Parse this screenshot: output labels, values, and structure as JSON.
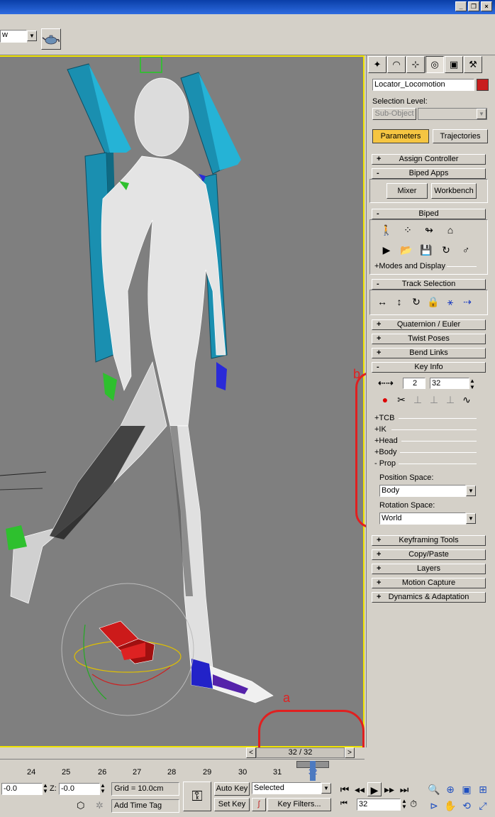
{
  "window": {
    "minimize": "_",
    "restore": "❐",
    "close": "×"
  },
  "toolbar": {
    "viewport_dropdown_value": "w"
  },
  "command_panel": {
    "object_name": "Locator_Locomotion",
    "object_color": "#cc2020",
    "selection_level_label": "Selection Level:",
    "subobject_button": "Sub-Object",
    "tabs": [
      "Parameters",
      "Trajectories"
    ],
    "rollouts_top": [
      {
        "sign": "+",
        "label": "Assign Controller"
      },
      {
        "sign": "-",
        "label": "Biped Apps"
      }
    ],
    "biped_apps": {
      "mixer": "Mixer",
      "workbench": "Workbench"
    },
    "biped_rollout": {
      "sign": "-",
      "label": "Biped"
    },
    "modes_and_display": "+Modes and Display",
    "track_selection": {
      "sign": "-",
      "label": "Track Selection"
    },
    "rollouts_mid": [
      {
        "sign": "+",
        "label": "Quaternion / Euler"
      },
      {
        "sign": "+",
        "label": "Twist Poses"
      },
      {
        "sign": "+",
        "label": "Bend Links"
      }
    ],
    "key_info": {
      "sign": "-",
      "label": "Key Info",
      "key_number": "2",
      "frame": "32",
      "subsections": [
        "+TCB",
        "+IK",
        "+Head",
        "+Body",
        "- Prop"
      ],
      "position_space_label": "Position Space:",
      "position_space_value": "Body",
      "rotation_space_label": "Rotation Space:",
      "rotation_space_value": "World"
    },
    "rollouts_bottom": [
      {
        "sign": "+",
        "label": "Keyframing Tools"
      },
      {
        "sign": "+",
        "label": "Copy/Paste"
      },
      {
        "sign": "+",
        "label": "Layers"
      },
      {
        "sign": "+",
        "label": "Motion Capture"
      },
      {
        "sign": "+",
        "label": "Dynamics & Adaptation"
      }
    ]
  },
  "annotations": {
    "a": "a",
    "b": "b",
    "ring_color": "#e02020"
  },
  "time_slider": {
    "position": "32 / 32",
    "prev": "<",
    "next": ">"
  },
  "timeline": {
    "ticks": [
      "24",
      "25",
      "26",
      "27",
      "28",
      "29",
      "30",
      "31",
      "32"
    ]
  },
  "status": {
    "y_value": "-0.0",
    "z_label": "Z:",
    "z_value": "-0.0",
    "grid": "Grid = 10.0cm",
    "auto_key": "Auto Key",
    "set_key": "Set Key",
    "selected": "Selected",
    "key_filters": "Key Filters...",
    "add_time_tag": "Add Time Tag",
    "current_frame": "32"
  },
  "colors": {
    "viewport_bg": "#7f7f7f",
    "viewport_border": "#f0e400",
    "active_tab": "#f5c542",
    "titlebar": "#0a3fa8"
  }
}
